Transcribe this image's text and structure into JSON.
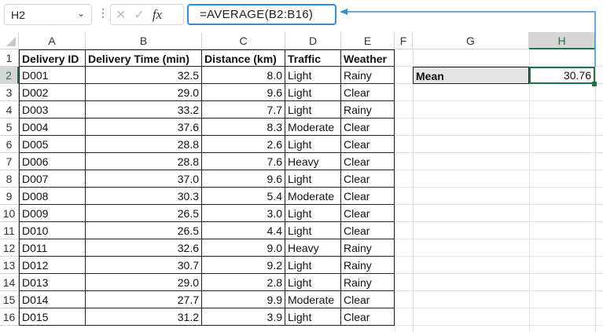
{
  "name_box": "H2",
  "formula": "=AVERAGE(B2:B16)",
  "fx_label": "fx",
  "columns": [
    "A",
    "B",
    "C",
    "D",
    "E",
    "F",
    "G",
    "H"
  ],
  "rows": [
    "1",
    "2",
    "3",
    "4",
    "5",
    "6",
    "7",
    "8",
    "9",
    "10",
    "11",
    "12",
    "13",
    "14",
    "15",
    "16"
  ],
  "headers": [
    "Delivery ID",
    "Delivery Time (min)",
    "Distance (km)",
    "Traffic",
    "Weather"
  ],
  "data": [
    [
      "D001",
      "32.5",
      "8.0",
      "Light",
      "Rainy"
    ],
    [
      "D002",
      "29.0",
      "9.6",
      "Light",
      "Clear"
    ],
    [
      "D003",
      "33.2",
      "7.7",
      "Light",
      "Rainy"
    ],
    [
      "D004",
      "37.6",
      "8.3",
      "Moderate",
      "Clear"
    ],
    [
      "D005",
      "28.8",
      "2.6",
      "Light",
      "Clear"
    ],
    [
      "D006",
      "28.8",
      "7.6",
      "Heavy",
      "Clear"
    ],
    [
      "D007",
      "37.0",
      "9.6",
      "Light",
      "Clear"
    ],
    [
      "D008",
      "30.3",
      "5.4",
      "Moderate",
      "Clear"
    ],
    [
      "D009",
      "26.5",
      "3.0",
      "Light",
      "Clear"
    ],
    [
      "D010",
      "26.5",
      "4.4",
      "Light",
      "Clear"
    ],
    [
      "D011",
      "32.6",
      "9.0",
      "Heavy",
      "Rainy"
    ],
    [
      "D012",
      "30.7",
      "9.2",
      "Light",
      "Rainy"
    ],
    [
      "D013",
      "29.0",
      "2.8",
      "Light",
      "Rainy"
    ],
    [
      "D014",
      "27.7",
      "9.9",
      "Moderate",
      "Clear"
    ],
    [
      "D015",
      "31.2",
      "3.9",
      "Light",
      "Clear"
    ]
  ],
  "mean_label": "Mean",
  "mean_value": "30.76"
}
